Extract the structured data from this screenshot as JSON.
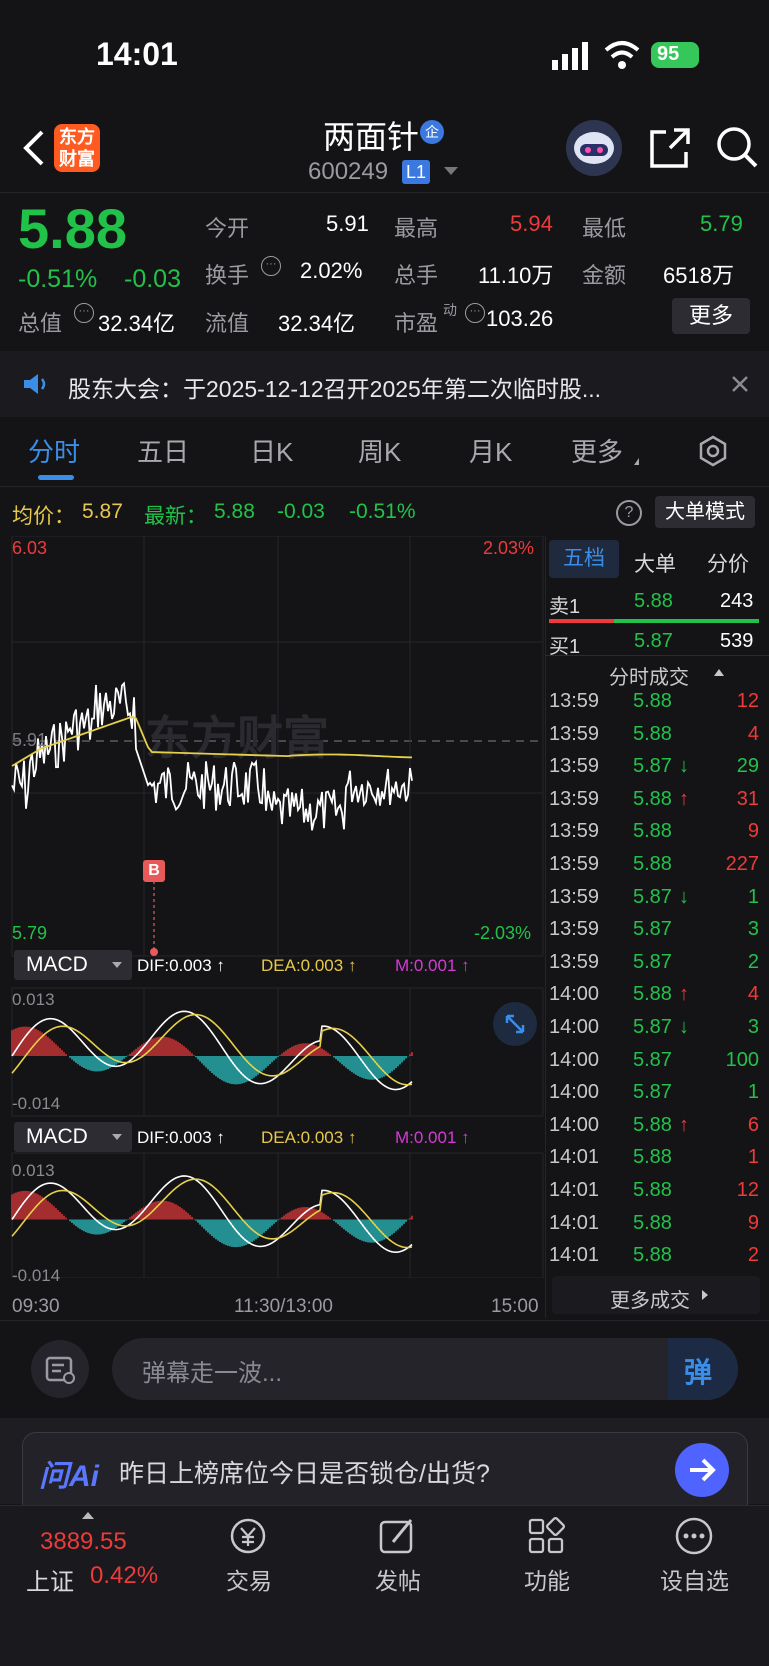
{
  "status_bar": {
    "time": "14:01",
    "battery": "95"
  },
  "header": {
    "stock_name": "两面针",
    "name_badge": "企",
    "code": "600249",
    "level_badge": "L1",
    "app_logo": "东方\n财富",
    "app_logo_line1": "东方",
    "app_logo_line2": "财富"
  },
  "quote": {
    "price": "5.88",
    "change_pct": "-0.51%",
    "change": "-0.03",
    "labels": {
      "open": "今开",
      "high": "最高",
      "low": "最低",
      "turnover": "换手",
      "volume": "总手",
      "amount": "金额",
      "total_value": "总值",
      "float_value": "流值",
      "pe": "市盈",
      "pe_sup": "动"
    },
    "open": "5.91",
    "high": "5.94",
    "low": "5.79",
    "turnover": "2.02%",
    "volume": "11.10万",
    "amount": "6518万",
    "total_value": "32.34亿",
    "float_value": "32.34亿",
    "pe": "103.26",
    "more_button": "更多"
  },
  "notice": {
    "text": "股东大会：于2025-12-12召开2025年第二次临时股..."
  },
  "tabs": [
    "分时",
    "五日",
    "日K",
    "周K",
    "月K",
    "更多"
  ],
  "info_bar": {
    "avg_label": "均价：",
    "avg_value": "5.87",
    "latest_label": "最新：",
    "latest_value": "5.88",
    "latest_change": "-0.03",
    "latest_pct": "-0.51%",
    "mode_button": "大单模式"
  },
  "chart_labels": {
    "top_price": "6.03",
    "top_pct": "2.03%",
    "mid_price": "5.91",
    "bottom_price": "5.79",
    "bottom_pct": "-2.03%",
    "b_marker": "B",
    "watermark": "东方财富"
  },
  "macd_panels": [
    {
      "name": "MACD",
      "dif": "DIF:0.003 ↑",
      "dea": "DEA:0.003 ↑",
      "m": "M:0.001 ↑",
      "top": "0.013",
      "bottom": "-0.014"
    },
    {
      "name": "MACD",
      "dif": "DIF:0.003 ↑",
      "dea": "DEA:0.003 ↑",
      "m": "M:0.001 ↑",
      "top": "0.013",
      "bottom": "-0.014"
    }
  ],
  "time_axis": {
    "start": "09:30",
    "mid": "11:30/13:00",
    "end": "15:00"
  },
  "side_panel": {
    "tabs": [
      "五档",
      "大单",
      "分价"
    ],
    "ask1": {
      "label": "卖1",
      "price": "5.88",
      "vol": "243"
    },
    "bid1": {
      "label": "买1",
      "price": "5.87",
      "vol": "539"
    },
    "ticks_title": "分时成交",
    "ticks": [
      {
        "time": "13:59",
        "price": "5.88",
        "arrow": "",
        "vol": "12",
        "color": "#ee3a3a"
      },
      {
        "time": "13:59",
        "price": "5.88",
        "arrow": "",
        "vol": "4",
        "color": "#ee3a3a"
      },
      {
        "time": "13:59",
        "price": "5.87",
        "arrow": "↓",
        "vol": "29",
        "color": "#22c24a"
      },
      {
        "time": "13:59",
        "price": "5.88",
        "arrow": "↑",
        "vol": "31",
        "color": "#ee3a3a"
      },
      {
        "time": "13:59",
        "price": "5.88",
        "arrow": "",
        "vol": "9",
        "color": "#ee3a3a"
      },
      {
        "time": "13:59",
        "price": "5.88",
        "arrow": "",
        "vol": "227",
        "color": "#ee3a3a"
      },
      {
        "time": "13:59",
        "price": "5.87",
        "arrow": "↓",
        "vol": "1",
        "color": "#22c24a"
      },
      {
        "time": "13:59",
        "price": "5.87",
        "arrow": "",
        "vol": "3",
        "color": "#22c24a"
      },
      {
        "time": "13:59",
        "price": "5.87",
        "arrow": "",
        "vol": "2",
        "color": "#22c24a"
      },
      {
        "time": "14:00",
        "price": "5.88",
        "arrow": "↑",
        "vol": "4",
        "color": "#ee3a3a"
      },
      {
        "time": "14:00",
        "price": "5.87",
        "arrow": "↓",
        "vol": "3",
        "color": "#22c24a"
      },
      {
        "time": "14:00",
        "price": "5.87",
        "arrow": "",
        "vol": "100",
        "color": "#22c24a"
      },
      {
        "time": "14:00",
        "price": "5.87",
        "arrow": "",
        "vol": "1",
        "color": "#22c24a"
      },
      {
        "time": "14:00",
        "price": "5.88",
        "arrow": "↑",
        "vol": "6",
        "color": "#ee3a3a"
      },
      {
        "time": "14:01",
        "price": "5.88",
        "arrow": "",
        "vol": "1",
        "color": "#ee3a3a"
      },
      {
        "time": "14:01",
        "price": "5.88",
        "arrow": "",
        "vol": "12",
        "color": "#ee3a3a"
      },
      {
        "time": "14:01",
        "price": "5.88",
        "arrow": "",
        "vol": "9",
        "color": "#ee3a3a"
      },
      {
        "time": "14:01",
        "price": "5.88",
        "arrow": "",
        "vol": "2",
        "color": "#ee3a3a"
      }
    ],
    "more_ticks": "更多成交"
  },
  "danmaku": {
    "placeholder": "弹幕走一波...",
    "send": "弹"
  },
  "ai_bar": {
    "brand": "问Ai",
    "text": "昨日上榜席位今日是否锁仓/出货?"
  },
  "bottom_nav": {
    "index_value": "3889.55",
    "index_name": "上证",
    "index_pct": "0.42%",
    "items": [
      "交易",
      "发帖",
      "功能",
      "设自选"
    ]
  },
  "colors": {
    "up": "#ee3a3a",
    "down": "#22c24a",
    "accent": "#3b8ee8",
    "avg_line": "#e6d04a",
    "price_line": "#ffffff"
  }
}
